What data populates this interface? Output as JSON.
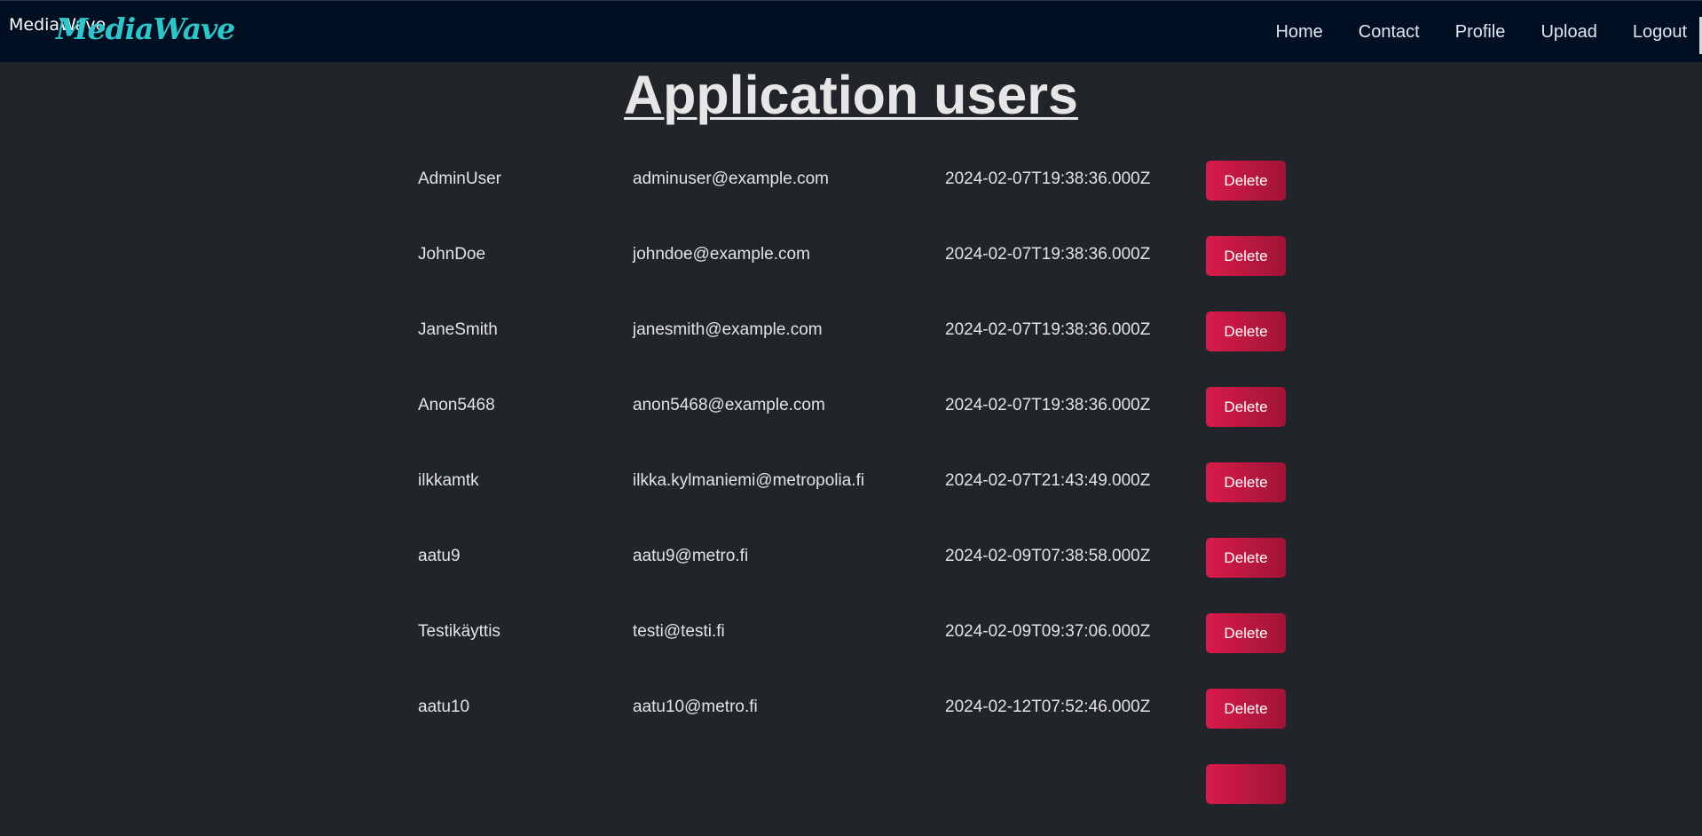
{
  "header": {
    "brand_text": "MediaWave",
    "logo_text": "MediaWave",
    "logo_color": "#2ec4c9",
    "background": "#000f21",
    "nav": [
      {
        "label": "Home"
      },
      {
        "label": "Contact"
      },
      {
        "label": "Profile"
      },
      {
        "label": "Upload"
      },
      {
        "label": "Logout"
      }
    ]
  },
  "main": {
    "title": "Application users",
    "delete_label": "Delete",
    "delete_color": "#d81b4a",
    "users": [
      {
        "username": "AdminUser",
        "email": "adminuser@example.com",
        "created": "2024-02-07T19:38:36.000Z"
      },
      {
        "username": "JohnDoe",
        "email": "johndoe@example.com",
        "created": "2024-02-07T19:38:36.000Z"
      },
      {
        "username": "JaneSmith",
        "email": "janesmith@example.com",
        "created": "2024-02-07T19:38:36.000Z"
      },
      {
        "username": "Anon5468",
        "email": "anon5468@example.com",
        "created": "2024-02-07T19:38:36.000Z"
      },
      {
        "username": "ilkkamtk",
        "email": "ilkka.kylmaniemi@metropolia.fi",
        "created": "2024-02-07T21:43:49.000Z"
      },
      {
        "username": "aatu9",
        "email": "aatu9@metro.fi",
        "created": "2024-02-09T07:38:58.000Z"
      },
      {
        "username": "Testikäyttis",
        "email": "testi@testi.fi",
        "created": "2024-02-09T09:37:06.000Z"
      },
      {
        "username": "aatu10",
        "email": "aatu10@metro.fi",
        "created": "2024-02-12T07:52:46.000Z"
      },
      {
        "username": "",
        "email": "",
        "created": ""
      }
    ]
  }
}
